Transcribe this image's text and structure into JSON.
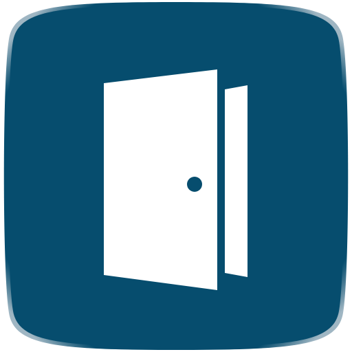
{
  "icon": {
    "name": "door-open-icon",
    "colors": {
      "tile": "#064d6e",
      "tile_edge": "#9fb6c3",
      "glyph": "#ffffff"
    }
  }
}
